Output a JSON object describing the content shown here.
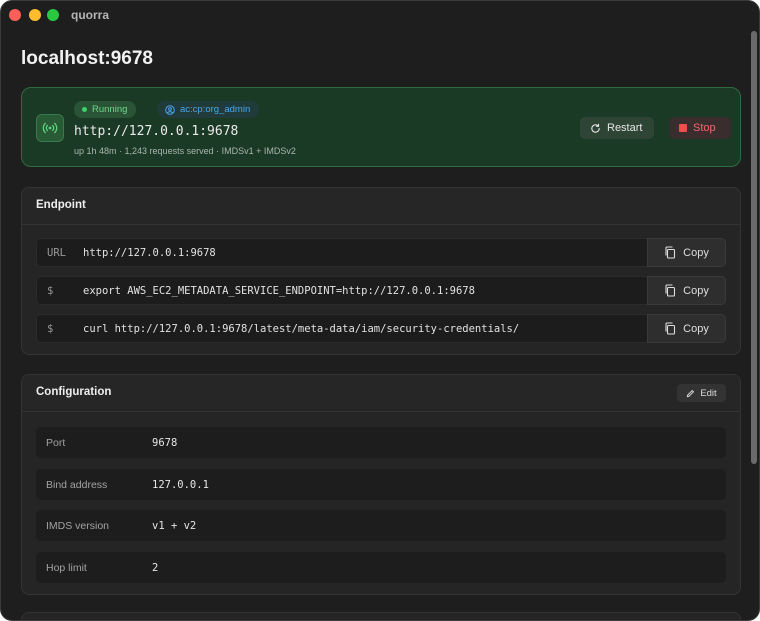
{
  "app": {
    "title": "quorra"
  },
  "page": {
    "title": "localhost:9678"
  },
  "status": {
    "state": "Running",
    "account": "ac:cp:org_admin",
    "url": "http://127.0.0.1:9678",
    "meta": "up 1h 48m · 1,243 requests served · IMDSv1 + IMDSv2",
    "restart_label": "Restart",
    "stop_label": "Stop",
    "colors": {
      "running": "#3cd26a",
      "stop": "#f04e4e",
      "account": "#4aa8ea"
    }
  },
  "endpoint": {
    "title": "Endpoint",
    "copy_label": "Copy",
    "rows": [
      {
        "prefix": "URL",
        "value": "http://127.0.0.1:9678"
      },
      {
        "prefix": "$",
        "value": "export AWS_EC2_METADATA_SERVICE_ENDPOINT=http://127.0.0.1:9678"
      },
      {
        "prefix": "$",
        "value": "curl http://127.0.0.1:9678/latest/meta-data/iam/security-credentials/"
      }
    ]
  },
  "configuration": {
    "title": "Configuration",
    "edit_label": "Edit",
    "rows": [
      {
        "key": "Port",
        "value": "9678"
      },
      {
        "key": "Bind address",
        "value": "127.0.0.1"
      },
      {
        "key": "IMDS version",
        "value": "v1 + v2"
      },
      {
        "key": "Hop limit",
        "value": "2"
      }
    ]
  },
  "icons": {
    "status": "broadcast-icon",
    "account": "user-circle-icon",
    "restart": "refresh-icon",
    "stop": "stop-icon",
    "copy": "copy-icon",
    "edit": "pencil-icon"
  }
}
